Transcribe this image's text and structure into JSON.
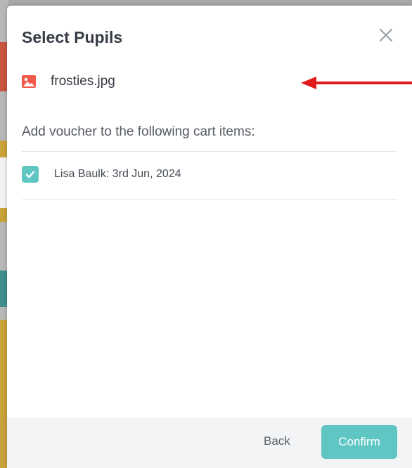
{
  "modal": {
    "title": "Select Pupils",
    "close_icon": "close-icon"
  },
  "file": {
    "icon": "image-icon",
    "name": "frosties.jpg"
  },
  "annotation": {
    "icon": "red-arrow-pointer",
    "color": "#e0191b"
  },
  "instruction": "Add voucher to the following cart items:",
  "cart_items": [
    {
      "label": "Lisa Baulk: 3rd Jun, 2024",
      "checked": true
    }
  ],
  "footer": {
    "back_label": "Back",
    "confirm_label": "Confirm"
  },
  "colors": {
    "accent": "#5fc6c4",
    "file_icon": "#f25b4c",
    "title_text": "#363b45"
  }
}
